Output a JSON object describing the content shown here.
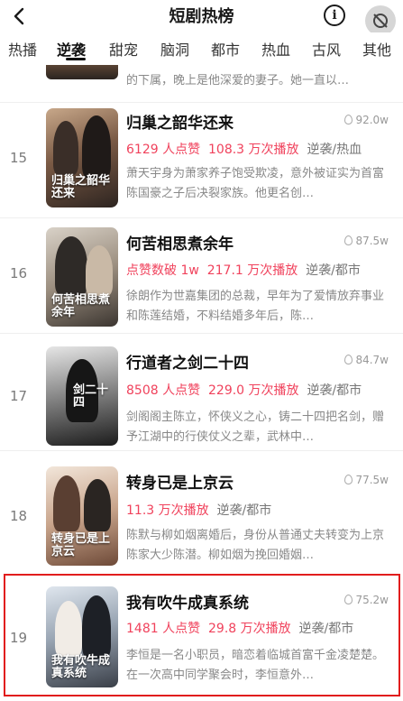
{
  "header": {
    "title": "短剧热榜",
    "back_icon": "chevron-left-icon",
    "info_label": "i"
  },
  "tabs": [
    {
      "label": "热播",
      "active": false
    },
    {
      "label": "逆袭",
      "active": true
    },
    {
      "label": "甜宠",
      "active": false
    },
    {
      "label": "脑洞",
      "active": false
    },
    {
      "label": "都市",
      "active": false
    },
    {
      "label": "热血",
      "active": false
    },
    {
      "label": "古风",
      "active": false
    },
    {
      "label": "其他",
      "active": false
    }
  ],
  "partial_item": {
    "desc": "的下属，晚上是他深爱的妻子。她一直以…"
  },
  "items": [
    {
      "rank": "15",
      "title": "归巢之韶华还来",
      "heat": "92.0w",
      "likes": "6129 人点赞",
      "plays": "108.3 万次播放",
      "tags": "逆袭/热血",
      "desc": "萧天宇身为萧家养子饱受欺凌，意外被证实为首富陈国豪之子后决裂家族。他更名创…",
      "cover_text": "归巢之韶华还来"
    },
    {
      "rank": "16",
      "title": "何苦相思煮余年",
      "heat": "87.5w",
      "likes": "点赞数破 1w",
      "plays": "217.1 万次播放",
      "tags": "逆袭/都市",
      "desc": "徐朗作为世嘉集团的总裁，早年为了爱情放弃事业和陈莲结婚，不料结婚多年后，陈…",
      "cover_text": "何苦相思煮余年"
    },
    {
      "rank": "17",
      "title": "行道者之剑二十四",
      "heat": "84.7w",
      "likes": "8508 人点赞",
      "plays": "229.0 万次播放",
      "tags": "逆袭/都市",
      "desc": "剑阁阁主陈立，怀侠义之心，铸二十四把名剑，赠予江湖中的行侠仗义之辈，武林中…",
      "cover_text": "剑二十四"
    },
    {
      "rank": "18",
      "title": "转身已是上京云",
      "heat": "77.5w",
      "likes": "",
      "plays": "11.3 万次播放",
      "tags": "逆袭/都市",
      "desc": "陈默与柳如烟离婚后，身份从普通丈夫转变为上京陈家大少陈潜。柳如烟为挽回婚姻…",
      "cover_text": "转身已是上京云"
    },
    {
      "rank": "19",
      "title": "我有吹牛成真系统",
      "heat": "75.2w",
      "likes": "1481 人点赞",
      "plays": "29.8 万次播放",
      "tags": "逆袭/都市",
      "desc": "李恒是一名小职员，暗恋着临城首富千金凌楚楚。在一次高中同学聚会时，李恒意外…",
      "cover_text": "我有吹牛成真系统"
    }
  ],
  "colors": {
    "accent": "#f0425c",
    "highlight_border": "#e11d1d"
  }
}
